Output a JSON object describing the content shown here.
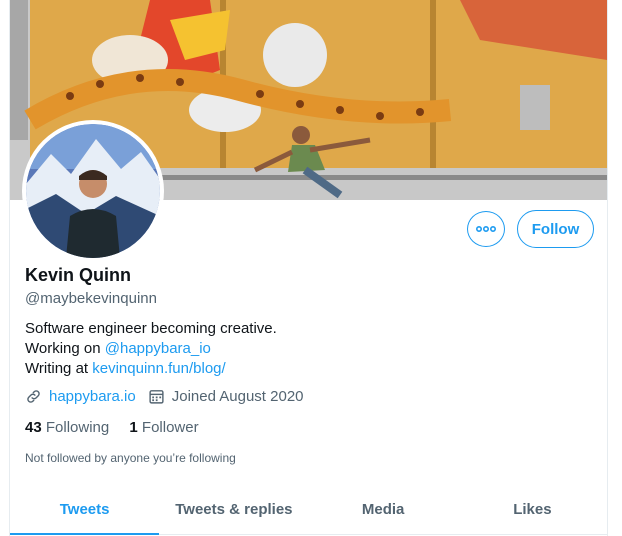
{
  "profile": {
    "name": "Kevin Quinn",
    "handle": "@maybekevinquinn",
    "bio_line1": "Software engineer becoming creative.",
    "bio_line2_prefix": "Working on ",
    "bio_line2_link": "@happybara_io",
    "bio_line3_prefix": "Writing at ",
    "bio_line3_link": "kevinquinn.fun/blog/",
    "website": "happybara.io",
    "joined": "Joined August 2020",
    "following_count": "43",
    "following_label": "Following",
    "followers_count": "1",
    "followers_label": "Follower",
    "not_followed_note": "Not followed by anyone you’re following"
  },
  "actions": {
    "more_icon": "more-horizontal-icon",
    "follow_label": "Follow"
  },
  "tabs": [
    {
      "label": "Tweets",
      "active": true
    },
    {
      "label": "Tweets & replies",
      "active": false
    },
    {
      "label": "Media",
      "active": false
    },
    {
      "label": "Likes",
      "active": false
    }
  ],
  "icons": {
    "website": "link-icon",
    "joined": "calendar-icon"
  },
  "colors": {
    "accent": "#1d9bf0",
    "text_primary": "#0f1419",
    "text_secondary": "#536471"
  }
}
